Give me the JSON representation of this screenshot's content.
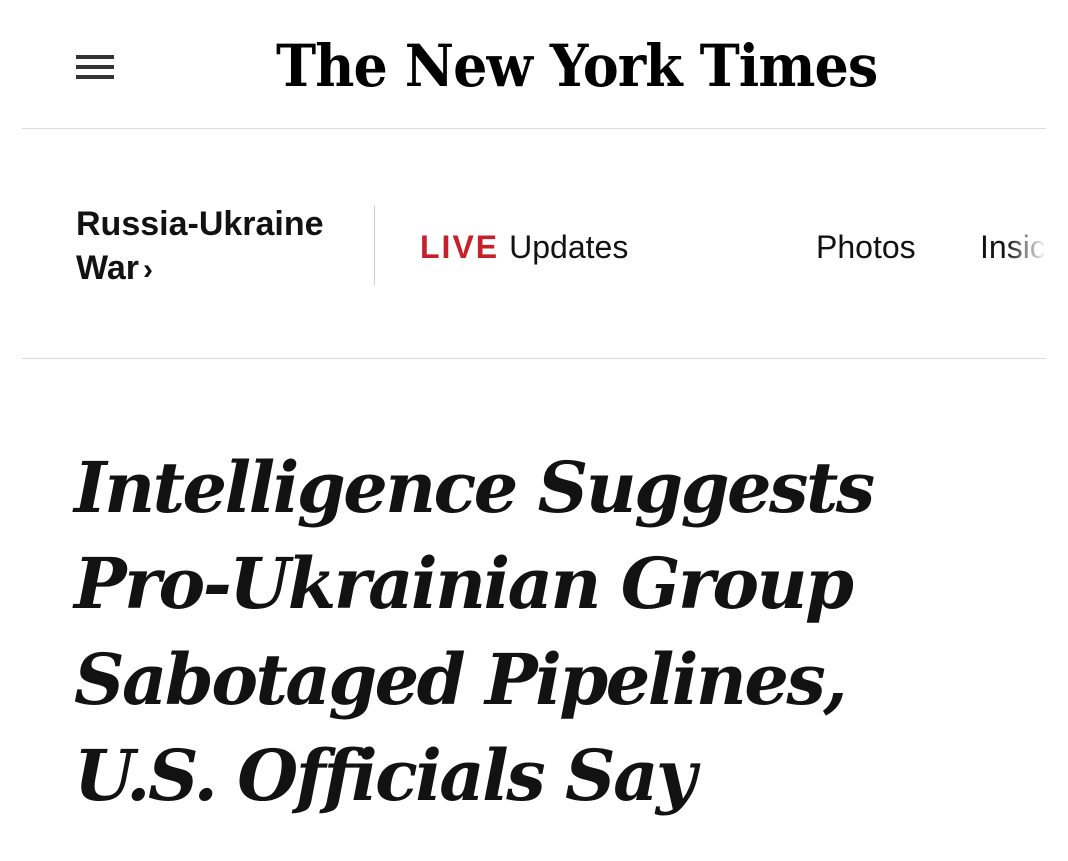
{
  "masthead": {
    "menu_icon": "hamburger-menu-icon",
    "logo_text": "The New York Times"
  },
  "section_nav": {
    "section_label": "Russia-Ukraine War",
    "section_chevron": "›",
    "items": [
      {
        "badge": "LIVE",
        "label": "Updates"
      },
      {
        "label": "Photos"
      },
      {
        "label": "Insic"
      }
    ]
  },
  "article": {
    "headline": "Intelligence Suggests Pro-Ukrainian Group Sabotaged Pipelines, U.S. Officials Say"
  },
  "colors": {
    "live_badge": "#c6202a",
    "text": "#121212",
    "divider": "#dcdcdc"
  }
}
